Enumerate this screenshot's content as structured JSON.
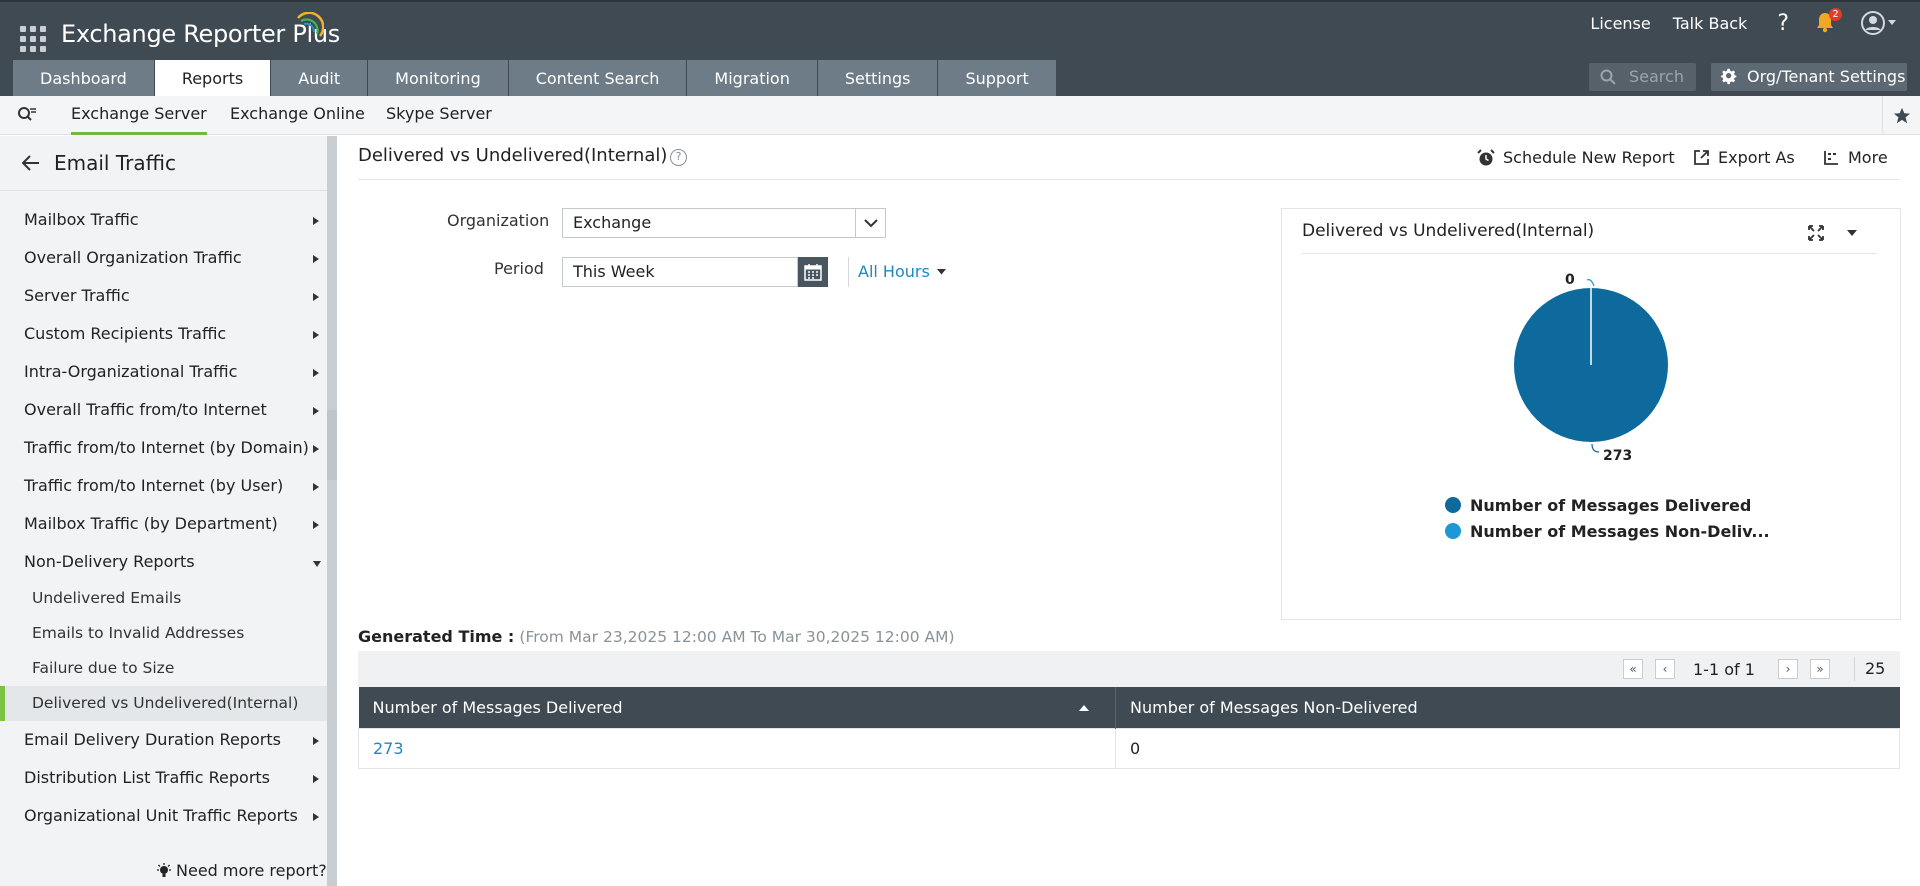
{
  "app": {
    "brand": "Exchange Reporter Plus",
    "top_links": [
      "License",
      "Talk Back"
    ],
    "help_symbol": "?",
    "notification_count": "2"
  },
  "tabs": [
    "Dashboard",
    "Reports",
    "Audit",
    "Monitoring",
    "Content Search",
    "Migration",
    "Settings",
    "Support"
  ],
  "active_tab": "Reports",
  "search": {
    "placeholder": "Search"
  },
  "org_button": "Org/Tenant Settings",
  "subnav": [
    "Exchange Server",
    "Exchange Online",
    "Skype Server"
  ],
  "sidebar": {
    "title": "Email Traffic",
    "items": [
      "Mailbox Traffic",
      "Overall Organization Traffic",
      "Server Traffic",
      "Custom Recipients Traffic",
      "Intra-Organizational Traffic",
      "Overall Traffic from/to Internet",
      "Traffic from/to Internet (by Domain)",
      "Traffic from/to Internet (by User)",
      "Mailbox Traffic (by Department)",
      "Non-Delivery Reports"
    ],
    "subitems": [
      "Undelivered Emails",
      "Emails to Invalid Addresses",
      "Failure due to Size",
      "Delivered vs Undelivered(Internal)"
    ],
    "items_after": [
      "Email Delivery Duration Reports",
      "Distribution List Traffic Reports",
      "Organizational Unit Traffic Reports"
    ],
    "need_more": "Need more report?"
  },
  "report": {
    "title": "Delivered vs Undelivered(Internal)",
    "help": "?",
    "actions": {
      "schedule": "Schedule New Report",
      "export": "Export As",
      "more": "More"
    },
    "organization_label": "Organization",
    "organization_value": "Exchange",
    "period_label": "Period",
    "period_value": "This Week",
    "hours": "All Hours",
    "generated_label": "Generated Time :",
    "generated_range": "(From Mar 23,2025 12:00 AM To Mar 30,2025 12:00 AM)"
  },
  "chart_data": {
    "type": "pie",
    "title": "Delivered vs Undelivered(Internal)",
    "series": [
      {
        "name": "Number of Messages Delivered",
        "value": 273,
        "color": "#0e6a9c"
      },
      {
        "name": "Number of Messages Non-Deliv...",
        "value": 0,
        "color": "#1d97d6"
      }
    ],
    "legend_position": "bottom"
  },
  "table": {
    "pager_text": "1-1 of 1",
    "page_size": "25",
    "columns": [
      "Number of Messages Delivered",
      "Number of Messages Non-Delivered"
    ],
    "rows": [
      [
        "273",
        "0"
      ]
    ]
  },
  "colors": {
    "header": "#3f4a53",
    "accent_green": "#7cc243",
    "link": "#1f87c4"
  }
}
